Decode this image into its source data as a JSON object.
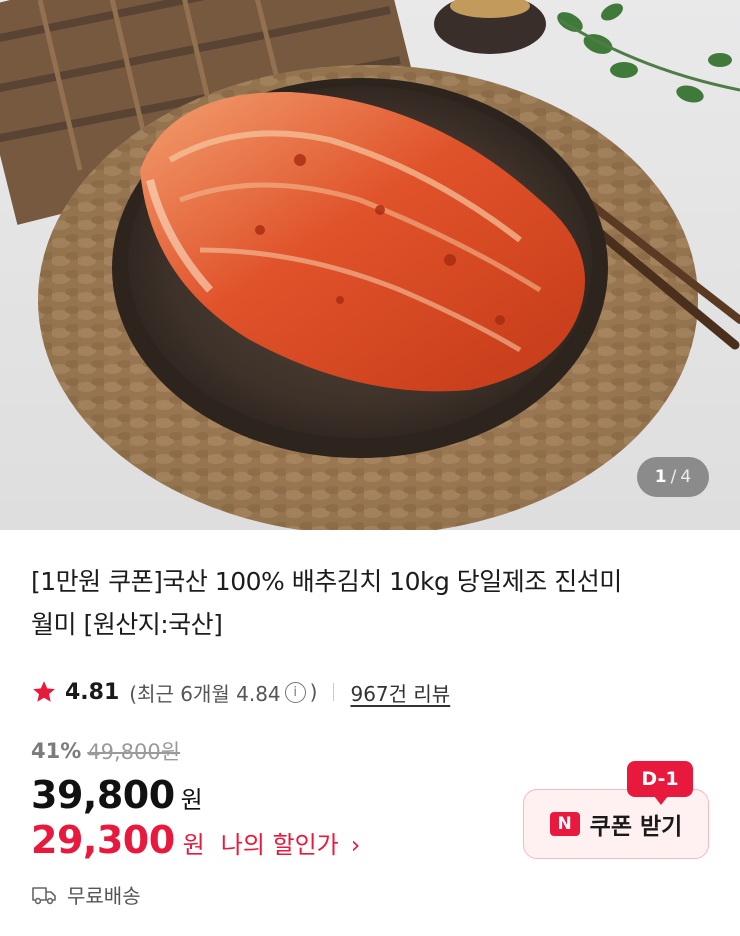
{
  "image_counter": {
    "current": "1",
    "separator": "/",
    "total": "4"
  },
  "product": {
    "title_line1": "[1만원 쿠폰]국산 100% 배추김치 10kg 당일제조 진선미",
    "title_line2": "월미 [원산지:국산]"
  },
  "rating": {
    "score": "4.81",
    "recent": "(최근 6개월 4.84",
    "recent_close": ")",
    "info_icon": "i",
    "reviews": "967건 리뷰"
  },
  "price": {
    "discount_rate": "41%",
    "original": "49,800원",
    "sale": "39,800",
    "sale_unit": "원",
    "my_price": "29,300",
    "my_price_unit": "원",
    "my_price_label": "나의 할인가",
    "my_price_chevron": "›"
  },
  "coupon": {
    "badge": "D-1",
    "icon_letter": "N",
    "label": "쿠폰 받기"
  },
  "shipping": {
    "label": "무료배송"
  },
  "colors": {
    "accent": "#e8193c",
    "coupon_bg": "#fff0f2",
    "star": "#e8193c"
  },
  "icons": [
    "star-icon",
    "info-icon",
    "chevron-right-icon",
    "naver-n-icon",
    "truck-icon"
  ]
}
